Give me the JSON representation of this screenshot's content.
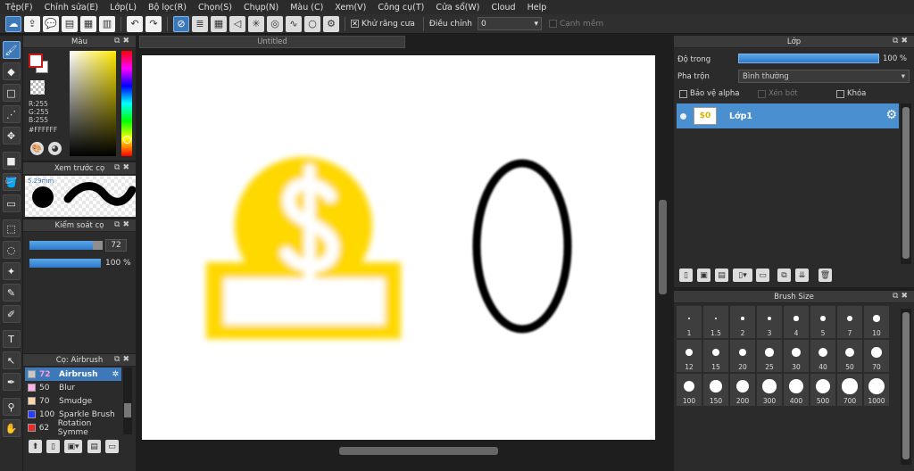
{
  "menu": [
    "Tệp(F)",
    "Chỉnh sửa(E)",
    "Lớp(L)",
    "Bộ lọc(R)",
    "Chọn(S)",
    "Chụp(N)",
    "Màu (C)",
    "Xem(V)",
    "Công cụ(T)",
    "Cửa sổ(W)",
    "Cloud",
    "Help"
  ],
  "toolbar": {
    "antialias_label": "Khử răng cưa",
    "antialias_checked": "✕",
    "adjust_label": "Điều chỉnh",
    "adjust_value": "0",
    "softedge_label": "Cạnh mềm"
  },
  "color_panel": {
    "title": "Màu",
    "r": "R:255",
    "g": "G:255",
    "b": "B:255",
    "hex": "#FFFFFF"
  },
  "preview_panel": {
    "title": "Xem trước cọ",
    "size": "5.29mm"
  },
  "control_panel": {
    "title": "Kiểm soát cọ",
    "size_value": "72",
    "size_fraction": 0.86,
    "opacity_value": "100 %",
    "opacity_fraction": 1.0
  },
  "brush_panel": {
    "title": "Cọ: Airbrush",
    "items": [
      {
        "size": "72",
        "name": "Airbrush",
        "color": "#c8c8c8",
        "selected": true
      },
      {
        "size": "50",
        "name": "Blur",
        "color": "#ffb0e8",
        "selected": false
      },
      {
        "size": "70",
        "name": "Smudge",
        "color": "#ffd6a8",
        "selected": false
      },
      {
        "size": "100",
        "name": "Sparkle Brush",
        "color": "#2a3cff",
        "selected": false
      },
      {
        "size": "62",
        "name": "Rotation Symme",
        "color": "#e82a2a",
        "selected": false
      }
    ]
  },
  "document": {
    "tab_title": "Untitled"
  },
  "layer_panel": {
    "title": "Lớp",
    "opacity_label": "Độ trong",
    "opacity_value": "100 %",
    "blend_label": "Pha trộn",
    "blend_value": "Bình thường",
    "protect_alpha": "Bảo vệ alpha",
    "clipping": "Xén bớt",
    "lock": "Khóa",
    "layer_name": "Lớp1"
  },
  "brush_size_panel": {
    "title": "Brush Size",
    "sizes": [
      "1",
      "1.5",
      "2",
      "3",
      "4",
      "5",
      "7",
      "10",
      "12",
      "15",
      "20",
      "25",
      "30",
      "40",
      "50",
      "70",
      "100",
      "150",
      "200",
      "300",
      "400",
      "500",
      "700",
      "1000"
    ]
  },
  "colors": {
    "accent": "#3d78b8",
    "coin_yellow": "#ffd800",
    "foreground_border": "#c41a1a"
  }
}
